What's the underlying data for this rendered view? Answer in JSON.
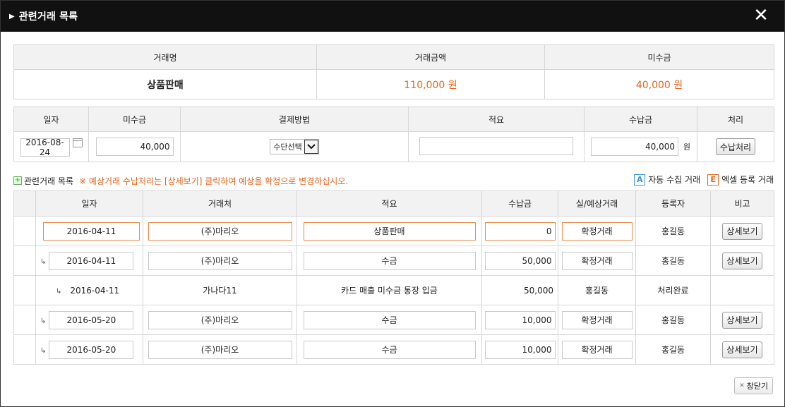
{
  "dialog": {
    "title": "관련거래 목록",
    "close_icon": "close-icon",
    "close_glyph": "✕"
  },
  "summary": {
    "headers": [
      "거래명",
      "거래금액",
      "미수금"
    ],
    "name": "상품판매",
    "amount": "110,000 원",
    "outstanding": "40,000 원"
  },
  "payment": {
    "headers": [
      "일자",
      "미수금",
      "결제방법",
      "적요",
      "수납금",
      "처리"
    ],
    "date": "2016-08-24",
    "outstanding": "40,000",
    "method": "수단선택",
    "memo": "",
    "received": "40,000",
    "unit": "원",
    "process_button": "수납처리"
  },
  "section": {
    "label": "관련거래 목록",
    "note": "※ 예상거래 수납처리는 [상세보기] 클릭하여 예상을 확정으로 변경하십시오.",
    "legend_auto_letter": "A",
    "legend_auto": "자동 수집 거래",
    "legend_excel_letter": "E",
    "legend_excel": "엑셀 등록 거래"
  },
  "list": {
    "headers": [
      "",
      "일자",
      "거래처",
      "적요",
      "수납금",
      "실/예상거래",
      "등록자",
      "비고"
    ],
    "sub_glyph": "↳",
    "rows": [
      {
        "type": "main",
        "date": "2016-04-11",
        "client": "(주)마리오",
        "memo": "상품판매",
        "amount": "0",
        "kind": "확정거래",
        "user": "홍길동",
        "action": "상세보기"
      },
      {
        "type": "sub",
        "date": "2016-04-11",
        "client": "(주)마리오",
        "memo": "수금",
        "amount": "50,000",
        "kind": "확정거래",
        "user": "홍길동",
        "action": "상세보기"
      },
      {
        "type": "plain",
        "date": "2016-04-11",
        "client": "가나다11",
        "memo": "카드 매출 미수금 통장 입금",
        "amount": "50,000",
        "kind": "홍길동",
        "user": "처리완료",
        "action": ""
      },
      {
        "type": "sub",
        "date": "2016-05-20",
        "client": "(주)마리오",
        "memo": "수금",
        "amount": "10,000",
        "kind": "확정거래",
        "user": "홍길동",
        "action": "상세보기"
      },
      {
        "type": "sub",
        "date": "2016-05-20",
        "client": "(주)마리오",
        "memo": "수금",
        "amount": "10,000",
        "kind": "확정거래",
        "user": "홍길동",
        "action": "상세보기"
      }
    ]
  },
  "footer": {
    "close_label": "창닫기",
    "close_glyph": "✕"
  }
}
